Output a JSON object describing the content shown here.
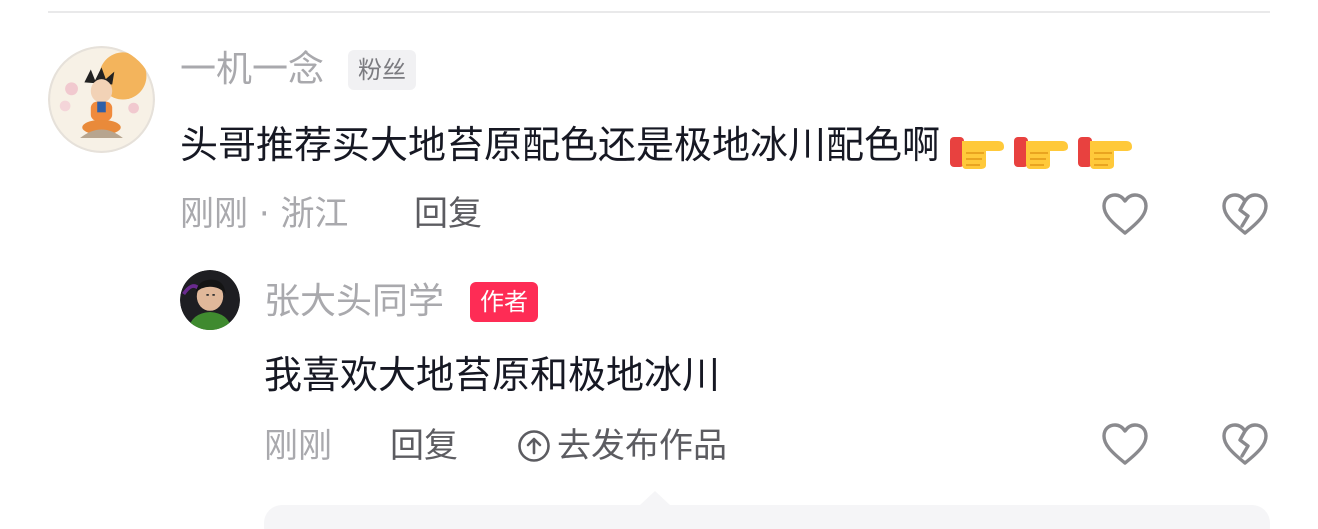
{
  "comment": {
    "username": "一机一念",
    "badge": "粉丝",
    "text": "头哥推荐买大地苔原配色还是极地冰川配色啊",
    "emoji": [
      "pointing-finger-emoji",
      "pointing-finger-emoji",
      "pointing-finger-emoji"
    ],
    "time": "刚刚",
    "separator": "·",
    "location": "浙江",
    "reply_label": "回复",
    "like_icon": "heart-outline-icon",
    "dislike_icon": "broken-heart-icon"
  },
  "reply": {
    "username": "张大头同学",
    "badge": "作者",
    "text": "我喜欢大地苔原和极地冰川",
    "time": "刚刚",
    "reply_label": "回复",
    "publish_label": "去发布作品",
    "publish_icon": "arrow-up-circle-icon",
    "like_icon": "heart-outline-icon",
    "dislike_icon": "broken-heart-icon"
  },
  "colors": {
    "author_badge": "#fe2c55",
    "text_primary": "#161823",
    "text_secondary": "#a9a9ad"
  }
}
